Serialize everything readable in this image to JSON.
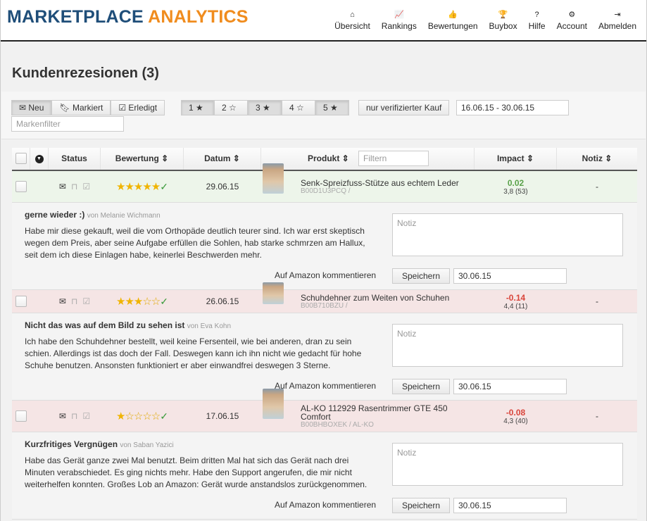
{
  "header": {
    "logo_part1": "MARKETPLACE",
    "logo_part2": "ANALYTICS",
    "nav": [
      {
        "label": "Übersicht",
        "icon": "home-icon",
        "glyph": "⌂"
      },
      {
        "label": "Rankings",
        "icon": "chart-line-icon",
        "glyph": "📈"
      },
      {
        "label": "Bewertungen",
        "icon": "thumbs-up-icon",
        "glyph": "👍"
      },
      {
        "label": "Buybox",
        "icon": "trophy-icon",
        "glyph": "🏆"
      },
      {
        "label": "Hilfe",
        "icon": "question-icon",
        "glyph": "?"
      },
      {
        "label": "Account",
        "icon": "gear-icon",
        "glyph": "⚙"
      },
      {
        "label": "Abmelden",
        "icon": "sign-out-icon",
        "glyph": "⇥"
      }
    ]
  },
  "page_title": "Kundenrezesionen (3)",
  "filters": {
    "status": [
      "Neu",
      "Markiert",
      "Erledigt"
    ],
    "stars": [
      "1 ★",
      "2 ☆",
      "3 ★",
      "4 ☆",
      "5 ★"
    ],
    "verified": "nur verifizierter Kauf",
    "date_range": "16.06.15 - 30.06.15",
    "brand_placeholder": "Markenfilter"
  },
  "table": {
    "headers": {
      "status": "Status",
      "rating": "Bewertung ⇕",
      "date": "Datum ⇕",
      "product": "Produkt ⇕",
      "impact": "Impact ⇕",
      "note": "Notiz ⇕"
    },
    "product_filter_placeholder": "Filtern",
    "rows": [
      {
        "stars": "★★★★★",
        "empty": "",
        "date": "29.06.15",
        "product": "Senk-Spreizfuss-Stütze aus echtem Leder",
        "asin": "B00D1U3PCQ /",
        "impact": "0.02",
        "rating": "3,8 (53)",
        "note": "-",
        "title": "gerne wieder :)",
        "author": "von Melanie Wichmann",
        "text": "Habe mir diese gekauft, weil die vom Orthopäde deutlich teurer sind. Ich war erst skeptisch wegen dem Preis, aber seine Aufgabe erfüllen die Sohlen, hab starke schmrzen am Hallux, seit dem ich diese Einlagen habe, keinerlei Beschwerden mehr.",
        "note_placeholder": "Notiz",
        "comment": "Auf Amazon kommentieren",
        "save": "Speichern",
        "save_date": "30.06.15"
      },
      {
        "stars": "★★★",
        "empty": "☆☆",
        "date": "26.06.15",
        "product": "Schuhdehner zum Weiten von Schuhen",
        "asin": "B00B710BZU /",
        "impact": "-0.14",
        "rating": "4,4 (11)",
        "note": "-",
        "title": "Nicht das was auf dem Bild zu sehen ist",
        "author": "von Eva Kohn",
        "text": "Ich habe den Schuhdehner bestellt, weil keine Fersenteil, wie bei anderen, dran zu sein schien. Allerdings ist das doch der Fall. Deswegen kann ich ihn nicht wie gedacht für hohe Schuhe benutzen. Ansonsten funktioniert er aber einwandfrei deswegen 3 Sterne.",
        "note_placeholder": "Notiz",
        "comment": "Auf Amazon kommentieren",
        "save": "Speichern",
        "save_date": "30.06.15"
      },
      {
        "stars": "★",
        "empty": "☆☆☆☆",
        "date": "17.06.15",
        "product": "AL-KO 112929 Rasentrimmer GTE 450 Comfort",
        "asin": "B00BHBOXEK / AL-KO",
        "impact": "-0.08",
        "rating": "4,3 (40)",
        "note": "-",
        "title": "Kurzfritiges Vergnügen",
        "author": "von Saban Yazici",
        "text": "Habe das Gerät ganze zwei Mal benutzt. Beim dritten Mal hat sich das Gerät nach drei Minuten verabschiedet. Es ging nichts mehr. Habe den Support angerufen, die mir nicht weiterhelfen konnten. Großes Lob an Amazon: Gerät wurde anstandslos zurückgenommen.",
        "note_placeholder": "Notiz",
        "comment": "Auf Amazon kommentieren",
        "save": "Speichern",
        "save_date": "30.06.15"
      }
    ]
  }
}
